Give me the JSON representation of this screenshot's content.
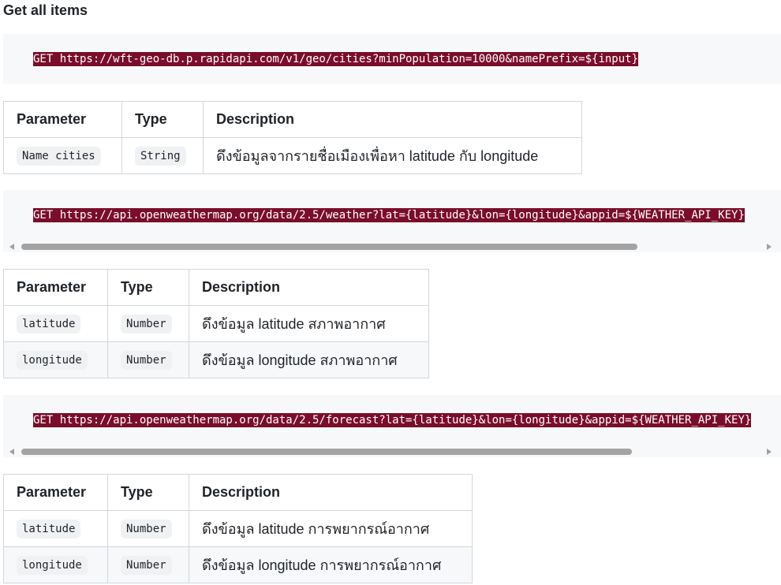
{
  "heading": "Get all items",
  "blocks": [
    {
      "code": "GET https://wft-geo-db.p.rapidapi.com/v1/geo/cities?minPopulation=10000&namePrefix=${input}"
    },
    {
      "code": "GET https://api.openweathermap.org/data/2.5/weather?lat={latitude}&lon={longitude}&appid=${WEATHER_API_KEY}"
    },
    {
      "code": "GET https://api.openweathermap.org/data/2.5/forecast?lat={latitude}&lon={longitude}&appid=${WEATHER_API_KEY}"
    }
  ],
  "tables": [
    {
      "headers": [
        "Parameter",
        "Type",
        "Description"
      ],
      "rows": [
        {
          "param": "Name cities",
          "type": "String",
          "desc": "ดึงข้อมูลจากรายชื่อเมืองเพื่อหา latitude กับ longitude"
        }
      ]
    },
    {
      "headers": [
        "Parameter",
        "Type",
        "Description"
      ],
      "rows": [
        {
          "param": "latitude",
          "type": "Number",
          "desc": "ดึงข้อมูล latitude สภาพอากาศ"
        },
        {
          "param": "longitude",
          "type": "Number",
          "desc": "ดึงข้อมูล longitude สภาพอากาศ"
        }
      ]
    },
    {
      "headers": [
        "Parameter",
        "Type",
        "Description"
      ],
      "rows": [
        {
          "param": "latitude",
          "type": "Number",
          "desc": "ดึงข้อมูล latitude การพยากรณ์อากาศ"
        },
        {
          "param": "longitude",
          "type": "Number",
          "desc": "ดึงข้อมูล longitude การพยากรณ์อากาศ"
        }
      ]
    }
  ],
  "colors": {
    "code_highlight_bg": "#7a0d2b",
    "code_block_bg": "#f6f8fa",
    "table_border": "#d0d7de"
  }
}
